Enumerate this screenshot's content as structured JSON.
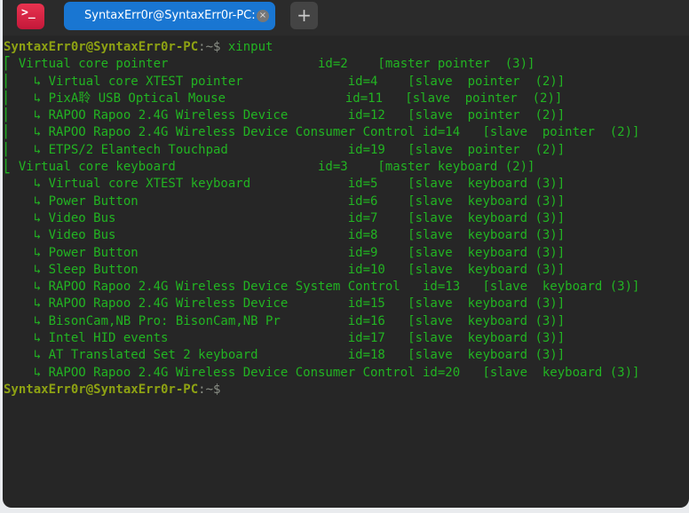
{
  "titlebar": {
    "app_icon": "terminal-icon",
    "app_icon_glyph": ">_",
    "tab_title": "SyntaxErr0r@SyntaxErr0r-PC: ~",
    "close_glyph": "×",
    "new_tab_glyph": "+"
  },
  "prompt": {
    "user_host": "SyntaxErr0r@SyntaxErr0r-PC",
    "path": ":~$",
    "command": " xinput"
  },
  "output": [
    "⎡ Virtual core pointer                    \tid=2    [master pointer  (3)]",
    "⎜   ↳ Virtual core XTEST pointer              id=4    [slave  pointer  (2)]",
    "⎜   ↳ PixA聆 USB Optical Mouse                id=11   [slave  pointer  (2)]",
    "⎜   ↳ RAPOO Rapoo 2.4G Wireless Device        id=12   [slave  pointer  (2)]",
    "⎜   ↳ RAPOO Rapoo 2.4G Wireless Device Consumer Control id=14   [slave  pointer  (2)]",
    "⎜   ↳ ETPS/2 Elantech Touchpad                id=19   [slave  pointer  (2)]",
    "⎣ Virtual core keyboard                   id=3    [master keyboard (2)]",
    "    ↳ Virtual core XTEST keyboard             id=5    [slave  keyboard (3)]",
    "    ↳ Power Button                            id=6    [slave  keyboard (3)]",
    "    ↳ Video Bus                               id=7    [slave  keyboard (3)]",
    "    ↳ Video Bus                               id=8    [slave  keyboard (3)]",
    "    ↳ Power Button                            id=9    [slave  keyboard (3)]",
    "    ↳ Sleep Button                            id=10   [slave  keyboard (3)]",
    "    ↳ RAPOO Rapoo 2.4G Wireless Device System Control   id=13   [slave  keyboard (3)]",
    "    ↳ RAPOO Rapoo 2.4G Wireless Device        id=15   [slave  keyboard (3)]",
    "    ↳ BisonCam,NB Pro: BisonCam,NB Pr         id=16   [slave  keyboard (3)]",
    "    ↳ Intel HID events                        id=17   [slave  keyboard (3)]",
    "    ↳ AT Translated Set 2 keyboard            id=18   [slave  keyboard (3)]",
    "    ↳ RAPOO Rapoo 2.4G Wireless Device Consumer Control id=20   [slave  keyboard (3)]"
  ]
}
